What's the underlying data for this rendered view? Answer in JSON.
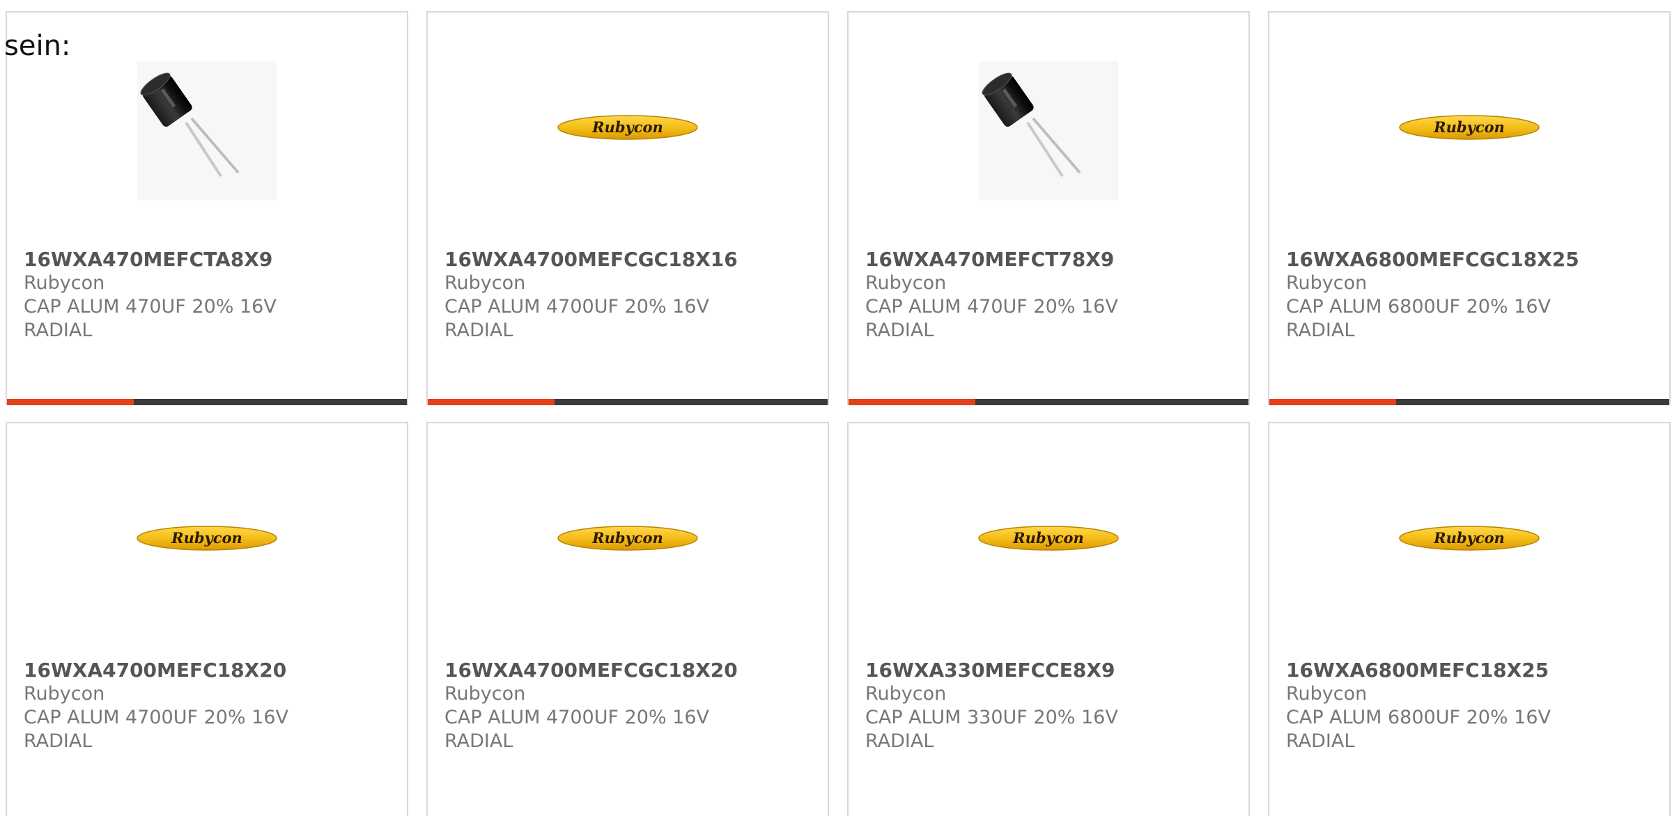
{
  "intro": "sein:",
  "colors": {
    "accent": "#e5401a",
    "bar": "#3b3b3b",
    "border": "#d8d8d8",
    "logo_yellow": "#f4c21c"
  },
  "products": [
    {
      "part_number": "16WXA470MEFCTA8X9",
      "manufacturer": "Rubycon",
      "description": "CAP ALUM 470UF 20% 16V RADIAL",
      "image": "capacitor-photo"
    },
    {
      "part_number": "16WXA4700MEFCGC18X16",
      "manufacturer": "Rubycon",
      "description": "CAP ALUM 4700UF 20% 16V RADIAL",
      "image": "rubycon-logo",
      "logo_text": "Rubycon"
    },
    {
      "part_number": "16WXA470MEFCT78X9",
      "manufacturer": "Rubycon",
      "description": "CAP ALUM 470UF 20% 16V RADIAL",
      "image": "capacitor-photo"
    },
    {
      "part_number": "16WXA6800MEFCGC18X25",
      "manufacturer": "Rubycon",
      "description": "CAP ALUM 6800UF 20% 16V RADIAL",
      "image": "rubycon-logo",
      "logo_text": "Rubycon"
    },
    {
      "part_number": "16WXA4700MEFC18X20",
      "manufacturer": "Rubycon",
      "description": "CAP ALUM 4700UF 20% 16V RADIAL",
      "image": "rubycon-logo",
      "logo_text": "Rubycon"
    },
    {
      "part_number": "16WXA4700MEFCGC18X20",
      "manufacturer": "Rubycon",
      "description": "CAP ALUM 4700UF 20% 16V RADIAL",
      "image": "rubycon-logo",
      "logo_text": "Rubycon"
    },
    {
      "part_number": "16WXA330MEFCCE8X9",
      "manufacturer": "Rubycon",
      "description": "CAP ALUM 330UF 20% 16V RADIAL",
      "image": "rubycon-logo",
      "logo_text": "Rubycon"
    },
    {
      "part_number": "16WXA6800MEFC18X25",
      "manufacturer": "Rubycon",
      "description": "CAP ALUM 6800UF 20% 16V RADIAL",
      "image": "rubycon-logo",
      "logo_text": "Rubycon"
    }
  ]
}
